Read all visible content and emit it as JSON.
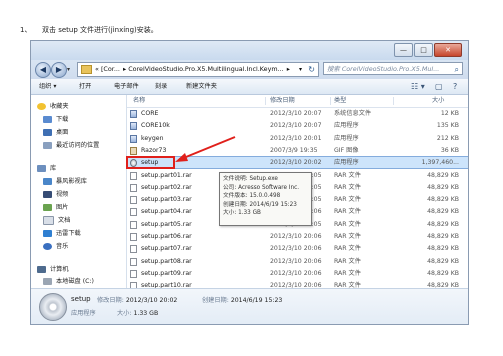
{
  "caption": {
    "number": "1、",
    "text": "双击 setup 文件进行(jìnxíng)安装。"
  },
  "window": {
    "controls": {
      "minimize": "—",
      "maximize": "□",
      "close": "✕"
    },
    "nav": {
      "back": "◀",
      "forward": "▶",
      "dropdown": "▾"
    },
    "address": {
      "segments": [
        "« [Cor...",
        "▸ CorelVideoStudio.Pro.X5.Multilingual.Incl.Keym...",
        "▸"
      ],
      "refresh": "↻",
      "dropdown": "▾"
    },
    "search": {
      "placeholder": "搜索 CorelVideoStudio.Pro.X5.Mul...",
      "icon": "⌕"
    },
    "toolbar": {
      "organize": "组织 ▾",
      "open": "打开",
      "email": "电子邮件",
      "burn": "刻录",
      "new_folder": "新建文件夹",
      "view": "☷ ▾",
      "pane": "▢",
      "help": "?"
    },
    "sidebar": [
      {
        "label": "收藏夹",
        "icon": "star-icon"
      },
      {
        "label": "下载",
        "icon": "download-icon"
      },
      {
        "label": "桌面",
        "icon": "desktop-icon"
      },
      {
        "label": "最近访问的位置",
        "icon": "recent-icon"
      },
      {
        "label": "库",
        "icon": "library-icon"
      },
      {
        "label": "暴风影视库",
        "icon": "video-lib-icon"
      },
      {
        "label": "视频",
        "icon": "video-icon"
      },
      {
        "label": "图片",
        "icon": "picture-icon"
      },
      {
        "label": "文档",
        "icon": "document-icon"
      },
      {
        "label": "迅雷下载",
        "icon": "thunder-icon"
      },
      {
        "label": "音乐",
        "icon": "music-icon"
      },
      {
        "label": "计算机",
        "icon": "computer-icon"
      },
      {
        "label": "本地磁盘 (C:)",
        "icon": "disk-icon"
      }
    ],
    "columns": {
      "name": "名称",
      "date": "修改日期",
      "type": "类型",
      "size": "大小"
    },
    "files": [
      {
        "name": "CORE",
        "date": "2012/3/10 20:07",
        "type": "系统信息文件",
        "size": "12 KB",
        "icon": "exe"
      },
      {
        "name": "CORE10k",
        "date": "2012/3/10 20:07",
        "type": "应用程序",
        "size": "135 KB",
        "icon": "exe"
      },
      {
        "name": "keygen",
        "date": "2012/3/10 20:01",
        "type": "应用程序",
        "size": "212 KB",
        "icon": "exe"
      },
      {
        "name": "Razor73",
        "date": "2007/3/9 19:35",
        "type": "GIF 图像",
        "size": "36 KB",
        "icon": "gif"
      },
      {
        "name": "setup",
        "date": "2012/3/10 20:02",
        "type": "应用程序",
        "size": "1,397,460...",
        "icon": "setup",
        "selected": true
      },
      {
        "name": "setup.part01.rar",
        "date": "2012/3/10 20:05",
        "type": "RAR 文件",
        "size": "48,829 KB",
        "icon": "rar"
      },
      {
        "name": "setup.part02.rar",
        "date": "2012/3/10 20:05",
        "type": "RAR 文件",
        "size": "48,829 KB",
        "icon": "rar"
      },
      {
        "name": "setup.part03.rar",
        "date": "2012/3/10 20:05",
        "type": "RAR 文件",
        "size": "48,829 KB",
        "icon": "rar"
      },
      {
        "name": "setup.part04.rar",
        "date": "2012/3/10 20:06",
        "type": "RAR 文件",
        "size": "48,829 KB",
        "icon": "rar"
      },
      {
        "name": "setup.part05.rar",
        "date": "2012/3/10 20:05",
        "type": "RAR 文件",
        "size": "48,829 KB",
        "icon": "rar"
      },
      {
        "name": "setup.part06.rar",
        "date": "2012/3/10 20:06",
        "type": "RAR 文件",
        "size": "48,829 KB",
        "icon": "rar"
      },
      {
        "name": "setup.part07.rar",
        "date": "2012/3/10 20:06",
        "type": "RAR 文件",
        "size": "48,829 KB",
        "icon": "rar"
      },
      {
        "name": "setup.part08.rar",
        "date": "2012/3/10 20:06",
        "type": "RAR 文件",
        "size": "48,829 KB",
        "icon": "rar"
      },
      {
        "name": "setup.part09.rar",
        "date": "2012/3/10 20:06",
        "type": "RAR 文件",
        "size": "48,829 KB",
        "icon": "rar"
      },
      {
        "name": "setup.part10.rar",
        "date": "2012/3/10 20:06",
        "type": "RAR 文件",
        "size": "48,829 KB",
        "icon": "rar"
      }
    ],
    "tooltip": {
      "line1": "文件说明: Setup.exe",
      "line2": "公司: Acresso Software Inc.",
      "line3": "文件版本: 15.0.0.498",
      "line4": "创建日期: 2014/6/19 15:23",
      "line5": "大小: 1.33 GB"
    },
    "details": {
      "name": "setup",
      "type": "应用程序",
      "modified_label": "修改日期:",
      "modified": "2012/3/10 20:02",
      "created_label": "创建日期:",
      "created": "2014/6/19 15:23",
      "size_label": "大小:",
      "size": "1.33 GB"
    },
    "highlight_color": "#e0201b"
  }
}
